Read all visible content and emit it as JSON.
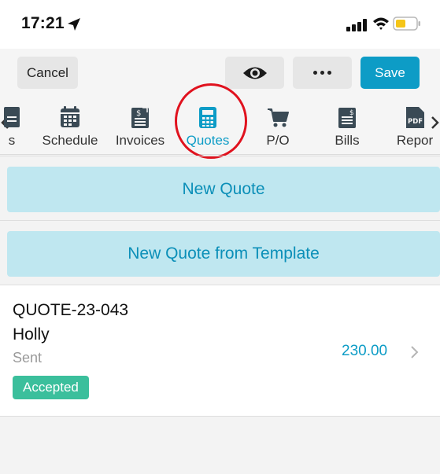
{
  "status_bar": {
    "time": "17:21"
  },
  "toolbar": {
    "cancel_label": "Cancel",
    "save_label": "Save"
  },
  "tabs": [
    {
      "label": "s",
      "icon": "doc-dollar-icon"
    },
    {
      "label": "Schedule",
      "icon": "calendar-icon"
    },
    {
      "label": "Invoices",
      "icon": "invoice-icon"
    },
    {
      "label": "Quotes",
      "icon": "calculator-icon",
      "active": true
    },
    {
      "label": "P/O",
      "icon": "cart-icon"
    },
    {
      "label": "Bills",
      "icon": "bill-icon"
    },
    {
      "label": "Repor",
      "icon": "pdf-icon"
    }
  ],
  "actions": {
    "new_quote": "New Quote",
    "new_quote_template": "New Quote from Template"
  },
  "quote": {
    "number": "QUOTE-23-043",
    "customer": "Holly",
    "status": "Sent",
    "badge": "Accepted",
    "amount": "230.00"
  },
  "colors": {
    "accent": "#0d9cc6",
    "highlight_circle": "#e0121e",
    "badge": "#3bbf9c"
  }
}
